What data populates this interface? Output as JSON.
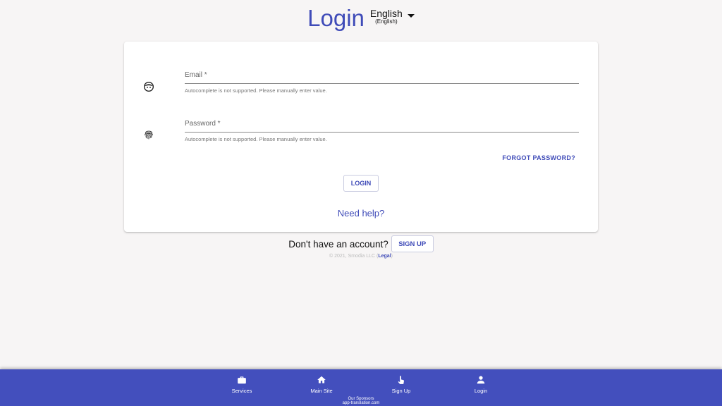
{
  "header": {
    "title": "Login",
    "language": "English",
    "language_native": "(English)"
  },
  "form": {
    "email": {
      "label": "Email *",
      "helper": "Autocomplete is not supported. Please manually enter value.",
      "icon": "face-icon"
    },
    "password": {
      "label": "Password *",
      "helper": "Autocomplete is not supported. Please manually enter value.",
      "icon": "fingerprint-icon"
    },
    "forgot_password": "FORGOT PASSWORD?",
    "login_button": "LOGIN",
    "need_help": "Need help?"
  },
  "signup": {
    "prompt": "Don't have an account?",
    "button": "SIGN UP"
  },
  "footer": {
    "copyright": "© 2021, Smodia LLC (",
    "legal": "Legal",
    "copyright_end": ")"
  },
  "bottom_nav": {
    "items": [
      {
        "label": "Services",
        "icon": "briefcase-icon"
      },
      {
        "label": "Main Site",
        "icon": "home-icon"
      },
      {
        "label": "Sign Up",
        "icon": "touch-icon"
      },
      {
        "label": "Login",
        "icon": "person-icon"
      }
    ],
    "sponsors_label": "Our Sponsors",
    "sponsors_site": "app-translation.com"
  },
  "colors": {
    "accent": "#3f4bb8",
    "nav_bg": "#434fbd",
    "page_bg": "#f7f5f5"
  }
}
